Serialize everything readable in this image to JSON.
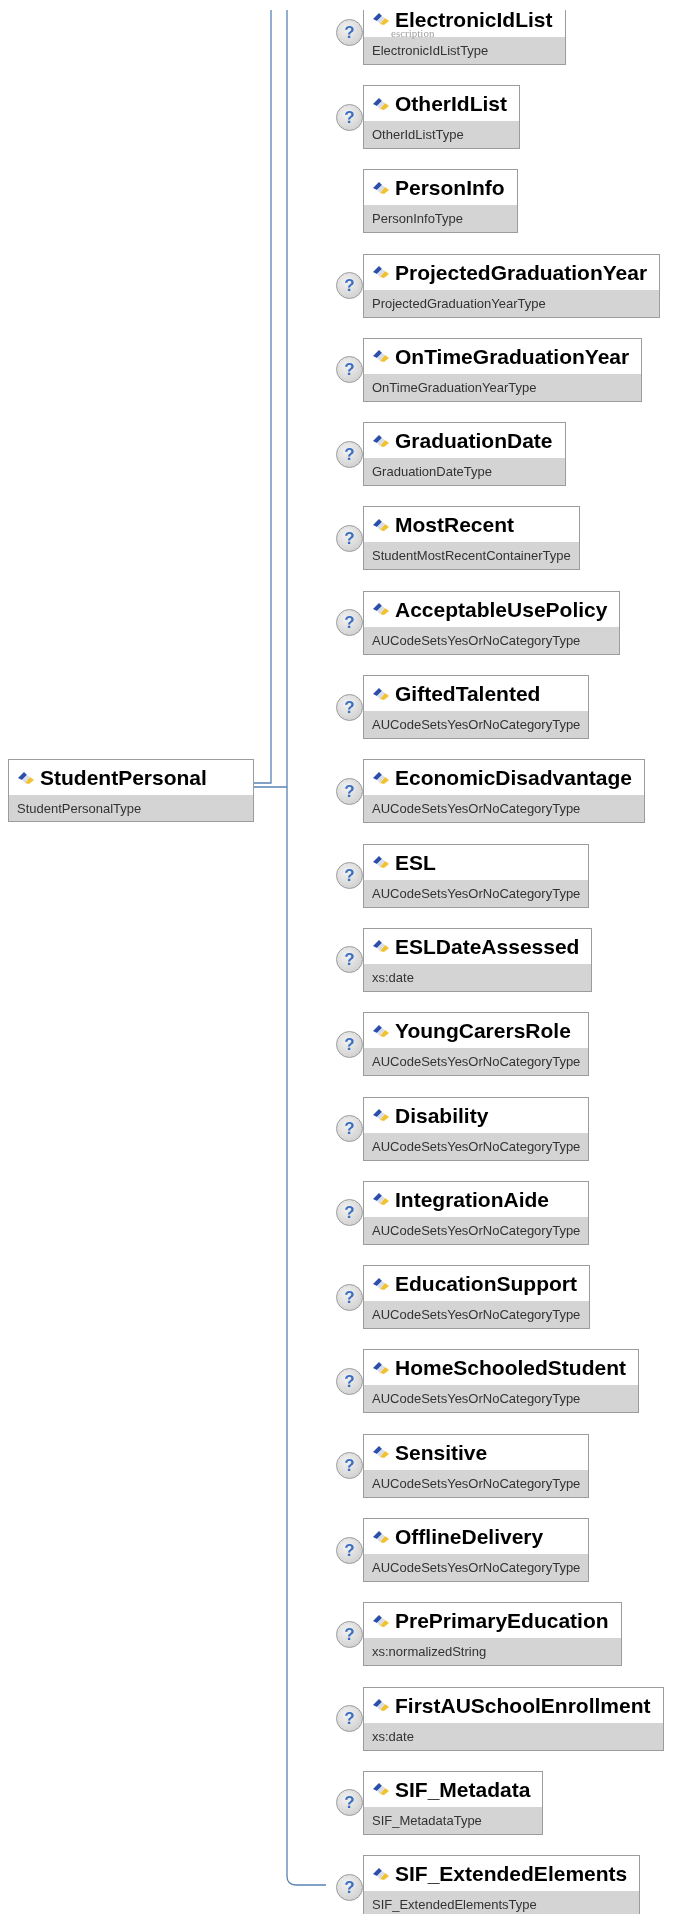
{
  "root": {
    "name": "StudentPersonal",
    "type": "StudentPersonalType"
  },
  "overlay_text": "escription",
  "children": [
    {
      "name": "ElectronicIdList",
      "type": "ElectronicIdListType",
      "help": "?"
    },
    {
      "name": "OtherIdList",
      "type": "OtherIdListType",
      "help": "?"
    },
    {
      "name": "PersonInfo",
      "type": "PersonInfoType"
    },
    {
      "name": "ProjectedGraduationYear",
      "type": "ProjectedGraduationYearType",
      "help": "?"
    },
    {
      "name": "OnTimeGraduationYear",
      "type": "OnTimeGraduationYearType",
      "help": "?"
    },
    {
      "name": "GraduationDate",
      "type": "GraduationDateType",
      "help": "?"
    },
    {
      "name": "MostRecent",
      "type": "StudentMostRecentContainerType",
      "help": "?"
    },
    {
      "name": "AcceptableUsePolicy",
      "type": "AUCodeSetsYesOrNoCategoryType",
      "help": "?"
    },
    {
      "name": "GiftedTalented",
      "type": "AUCodeSetsYesOrNoCategoryType",
      "help": "?"
    },
    {
      "name": "EconomicDisadvantage",
      "type": "AUCodeSetsYesOrNoCategoryType",
      "help": "?"
    },
    {
      "name": "ESL",
      "type": "AUCodeSetsYesOrNoCategoryType",
      "help": "?"
    },
    {
      "name": "ESLDateAssessed",
      "type": "xs:date",
      "help": "?"
    },
    {
      "name": "YoungCarersRole",
      "type": "AUCodeSetsYesOrNoCategoryType",
      "help": "?"
    },
    {
      "name": "Disability",
      "type": "AUCodeSetsYesOrNoCategoryType",
      "help": "?"
    },
    {
      "name": "IntegrationAide",
      "type": "AUCodeSetsYesOrNoCategoryType",
      "help": "?"
    },
    {
      "name": "EducationSupport",
      "type": "AUCodeSetsYesOrNoCategoryType",
      "help": "?"
    },
    {
      "name": "HomeSchooledStudent",
      "type": "AUCodeSetsYesOrNoCategoryType",
      "help": "?"
    },
    {
      "name": "Sensitive",
      "type": "AUCodeSetsYesOrNoCategoryType",
      "help": "?"
    },
    {
      "name": "OfflineDelivery",
      "type": "AUCodeSetsYesOrNoCategoryType",
      "help": "?"
    },
    {
      "name": "PrePrimaryEducation",
      "type": "xs:normalizedString",
      "help": "?"
    },
    {
      "name": "FirstAUSchoolEnrollment",
      "type": "xs:date",
      "help": "?"
    },
    {
      "name": "SIF_Metadata",
      "type": "SIF_MetadataType",
      "help": "?"
    },
    {
      "name": "SIF_ExtendedElements",
      "type": "SIF_ExtendedElementsType",
      "help": "?"
    }
  ]
}
